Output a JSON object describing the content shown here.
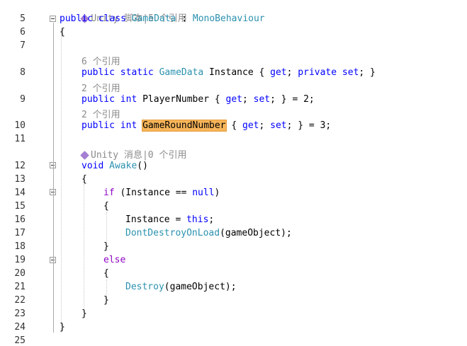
{
  "code": {
    "top_hint": "Unity 脚本|5 个引用",
    "awake_hint": "Unity 消息|0 个引用",
    "ref_hint_6": "6 个引用",
    "ref_hint_2a": "2 个引用",
    "ref_hint_2b": "2 个引用",
    "line_numbers": [
      "5",
      "6",
      "7",
      "8",
      "9",
      "10",
      "11",
      "12",
      "13",
      "14",
      "15",
      "16",
      "17",
      "18",
      "19",
      "20",
      "21",
      "22",
      "23",
      "24",
      "25"
    ],
    "kw_public": "public",
    "kw_class": "class",
    "class_name": "GameData",
    "colon": " : ",
    "base_class": "MonoBehaviour",
    "open_brace": "{",
    "close_brace": "}",
    "kw_static": "static",
    "type_gamedata": "GameData",
    "prop_instance": "Instance",
    "getset_private": "{ get; private set; }",
    "kw_int": "int",
    "prop_player": "PlayerNumber",
    "getset_assign2": "{ get; set; } = 2;",
    "prop_round": "GameRoundNumber",
    "getset_assign3": " { get; set; } = 3;",
    "kw_void": "void",
    "method_awake": "Awake",
    "parens": "()",
    "kw_if": "if",
    "cond": " (Instance == ",
    "kw_null": "null",
    "cond_close": ")",
    "assign_instance": "Instance = ",
    "kw_this": "this",
    "semi": ";",
    "dontdestroy": "DontDestroyOnLoad",
    "go_arg": "(gameObject);",
    "kw_else": "else",
    "destroy": "Destroy",
    "lbl_get": "get",
    "lbl_set": "set"
  }
}
